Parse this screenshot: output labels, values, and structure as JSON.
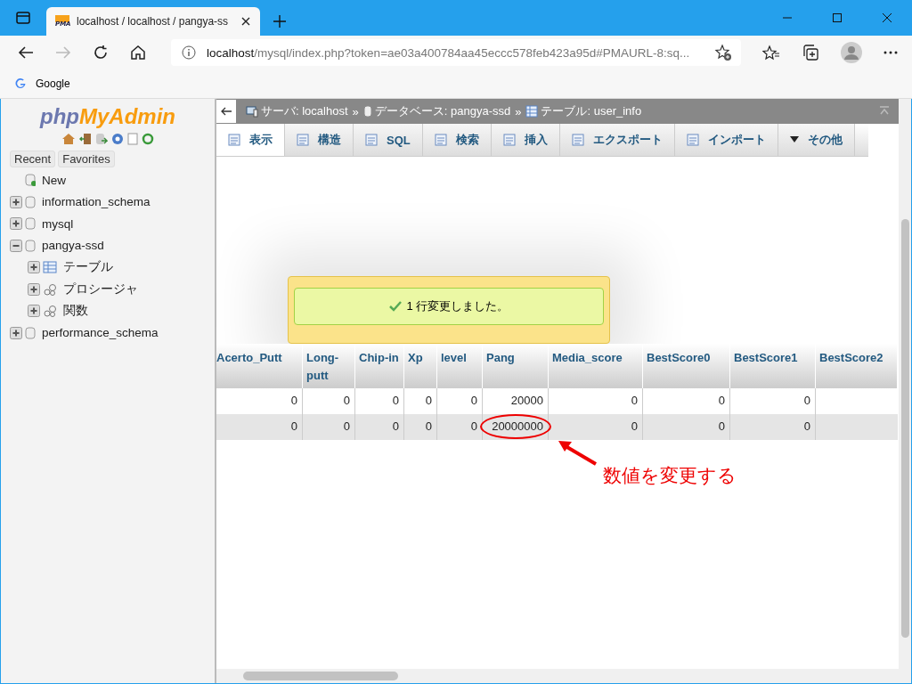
{
  "browser": {
    "tab_title": "localhost / localhost / pangya-ss",
    "tab_favicon": "PMA",
    "url_host": "localhost",
    "url_rest": "/mysql/index.php?token=ae03a400784aa45eccc578feb423a95d#PMAURL-8:sq...",
    "bookmarks": [
      "Google"
    ]
  },
  "sidebar": {
    "logo_php": "php",
    "logo_rest": "MyAdmin",
    "buttons": [
      {
        "label": "Recent"
      },
      {
        "label": "Favorites"
      }
    ],
    "tree": [
      {
        "label": "New",
        "kind": "new"
      },
      {
        "label": "information_schema",
        "kind": "db",
        "expanded": false
      },
      {
        "label": "mysql",
        "kind": "db",
        "expanded": false
      },
      {
        "label": "pangya-ssd",
        "kind": "db",
        "expanded": true,
        "children": [
          {
            "label": "テーブル",
            "kind": "table",
            "expanded": false
          },
          {
            "label": "プロシージャ",
            "kind": "proc",
            "expanded": false
          },
          {
            "label": "関数",
            "kind": "proc",
            "expanded": false
          }
        ]
      },
      {
        "label": "performance_schema",
        "kind": "db",
        "expanded": false
      }
    ]
  },
  "breadcrumb": [
    {
      "label": "サーバ: localhost",
      "kind": "server"
    },
    {
      "label": "データベース: pangya-ssd",
      "kind": "db"
    },
    {
      "label": "テーブル: user_info",
      "kind": "table"
    }
  ],
  "breadcrumb_sep": "»",
  "tabs": [
    {
      "label": "表示",
      "selected": true
    },
    {
      "label": "構造",
      "selected": false
    },
    {
      "label": "SQL",
      "selected": false
    },
    {
      "label": "検索",
      "selected": false
    },
    {
      "label": "挿入",
      "selected": false
    },
    {
      "label": "エクスポート",
      "selected": false
    },
    {
      "label": "インポート",
      "selected": false
    },
    {
      "label": "その他",
      "selected": false
    }
  ],
  "message": "1 行変更しました。",
  "table": {
    "columns": [
      "Acerto_Putt",
      "Long-putt",
      "Chip-in",
      "Xp",
      "level",
      "Pang",
      "Media_score",
      "BestScore0",
      "BestScore1",
      "BestScore2"
    ],
    "rows": [
      [
        "0",
        "0",
        "0",
        "0",
        "0",
        "20000",
        "0",
        "0",
        "0"
      ],
      [
        "0",
        "0",
        "0",
        "0",
        "0",
        "20000000",
        "0",
        "0",
        "0"
      ]
    ]
  },
  "annotation": "数値を変更する"
}
